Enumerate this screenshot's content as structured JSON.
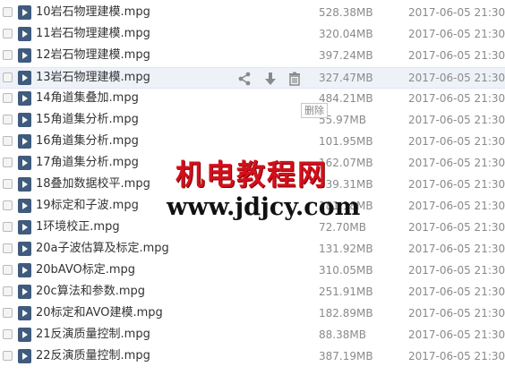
{
  "files": [
    {
      "name": "10岩石物理建模.mpg",
      "size": "528.38MB",
      "date": "2017-06-05 21:30",
      "hovered": false
    },
    {
      "name": "11岩石物理建模.mpg",
      "size": "320.04MB",
      "date": "2017-06-05 21:30",
      "hovered": false
    },
    {
      "name": "12岩石物理建模.mpg",
      "size": "397.24MB",
      "date": "2017-06-05 21:30",
      "hovered": false
    },
    {
      "name": "13岩石物理建模.mpg",
      "size": "327.47MB",
      "date": "2017-06-05 21:30",
      "hovered": true
    },
    {
      "name": "14角道集叠加.mpg",
      "size": "484.21MB",
      "date": "2017-06-05 21:30",
      "hovered": false
    },
    {
      "name": "15角道集分析.mpg",
      "size": "55.97MB",
      "date": "2017-06-05 21:30",
      "hovered": false
    },
    {
      "name": "16角道集分析.mpg",
      "size": "101.95MB",
      "date": "2017-06-05 21:30",
      "hovered": false
    },
    {
      "name": "17角道集分析.mpg",
      "size": "162.07MB",
      "date": "2017-06-05 21:30",
      "hovered": false
    },
    {
      "name": "18叠加数据校平.mpg",
      "size": "139.31MB",
      "date": "2017-06-05 21:30",
      "hovered": false
    },
    {
      "name": "19标定和子波.mpg",
      "size": "181.18MB",
      "date": "2017-06-05 21:30",
      "hovered": false
    },
    {
      "name": "1环境校正.mpg",
      "size": "72.70MB",
      "date": "2017-06-05 21:30",
      "hovered": false
    },
    {
      "name": "20a子波估算及标定.mpg",
      "size": "131.92MB",
      "date": "2017-06-05 21:30",
      "hovered": false
    },
    {
      "name": "20bAVO标定.mpg",
      "size": "310.05MB",
      "date": "2017-06-05 21:30",
      "hovered": false
    },
    {
      "name": "20c算法和参数.mpg",
      "size": "251.91MB",
      "date": "2017-06-05 21:30",
      "hovered": false
    },
    {
      "name": "20标定和AVO建模.mpg",
      "size": "182.89MB",
      "date": "2017-06-05 21:30",
      "hovered": false
    },
    {
      "name": "21反演质量控制.mpg",
      "size": "88.38MB",
      "date": "2017-06-05 21:30",
      "hovered": false
    },
    {
      "name": "22反演质量控制.mpg",
      "size": "387.19MB",
      "date": "2017-06-05 21:30",
      "hovered": false
    }
  ],
  "row_actions": {
    "share_icon": "share-icon",
    "download_icon": "download-icon",
    "delete_icon": "trash-icon"
  },
  "tooltip": {
    "label": "删除"
  },
  "watermark": {
    "title": "机电教程网",
    "url": "www.jdjcy.com"
  },
  "colors": {
    "icon_blue": "#3f5b7d",
    "hover_bg": "#eef2f8",
    "watermark_red": "#d3101a"
  }
}
